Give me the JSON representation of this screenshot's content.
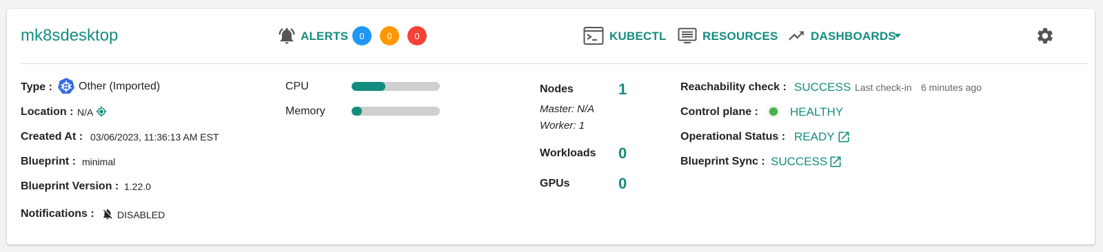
{
  "cluster": {
    "name": "mk8sdesktop"
  },
  "header": {
    "alerts_label": "ALERTS",
    "alert_counts": [
      {
        "value": "0",
        "color": "#2196f3"
      },
      {
        "value": "0",
        "color": "#ff9800"
      },
      {
        "value": "0",
        "color": "#f44336"
      }
    ],
    "kubectl_label": "KUBECTL",
    "resources_label": "RESOURCES",
    "dashboards_label": "DASHBOARDS"
  },
  "details": {
    "type_label": "Type :",
    "type_value": "Other (Imported)",
    "location_label": "Location :",
    "location_value": "N/A",
    "created_label": "Created At :",
    "created_value": "03/06/2023, 11:36:13 AM EST",
    "blueprint_label": "Blueprint :",
    "blueprint_value": "minimal",
    "blueprint_version_label": "Blueprint Version :",
    "blueprint_version_value": "1.22.0",
    "notifications_label": "Notifications :",
    "notifications_value": "DISABLED"
  },
  "usage": {
    "cpu_label": "CPU",
    "cpu_fraction": 0.38,
    "memory_label": "Memory",
    "memory_fraction": 0.12
  },
  "counts": {
    "nodes_label": "Nodes",
    "nodes_value": "1",
    "master": "Master: N/A",
    "worker": "Worker: 1",
    "workloads_label": "Workloads",
    "workloads_value": "0",
    "gpus_label": "GPUs",
    "gpus_value": "0"
  },
  "health": {
    "reachability_label": "Reachability check :",
    "reachability_value": "SUCCESS",
    "last_checkin_label": "Last check-in",
    "last_checkin_value": "6 minutes ago",
    "control_plane_label": "Control plane :",
    "control_plane_value": "HEALTHY",
    "control_plane_color": "#4caf50",
    "operational_label": "Operational Status :",
    "operational_value": "READY",
    "blueprint_sync_label": "Blueprint Sync :",
    "blueprint_sync_value": "SUCCESS"
  },
  "colors": {
    "accent": "#138d7f"
  }
}
